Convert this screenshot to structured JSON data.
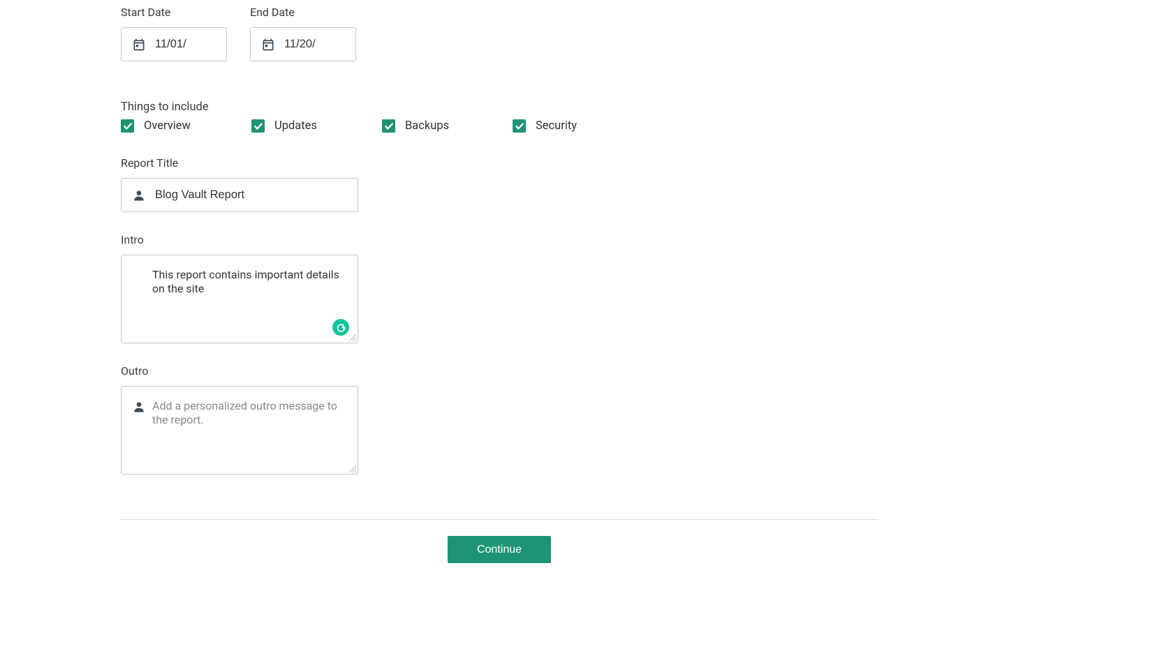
{
  "labels": {
    "start_date": "Start Date",
    "end_date": "End Date",
    "things_to_include": "Things to include",
    "report_title": "Report Title",
    "intro": "Intro",
    "outro": "Outro"
  },
  "values": {
    "start_date": "11/01/",
    "end_date": "11/20/",
    "report_title": "Blog Vault Report",
    "intro": "This report contains important details on the site",
    "outro": ""
  },
  "placeholders": {
    "outro": "Add a personalized outro message to the report."
  },
  "checkboxes": [
    {
      "label": "Overview",
      "checked": true
    },
    {
      "label": "Updates",
      "checked": true
    },
    {
      "label": "Backups",
      "checked": true
    },
    {
      "label": "Security",
      "checked": true
    }
  ],
  "buttons": {
    "continue": "Continue"
  },
  "colors": {
    "accent": "#1f9475",
    "grammarly": "#15c39a"
  }
}
